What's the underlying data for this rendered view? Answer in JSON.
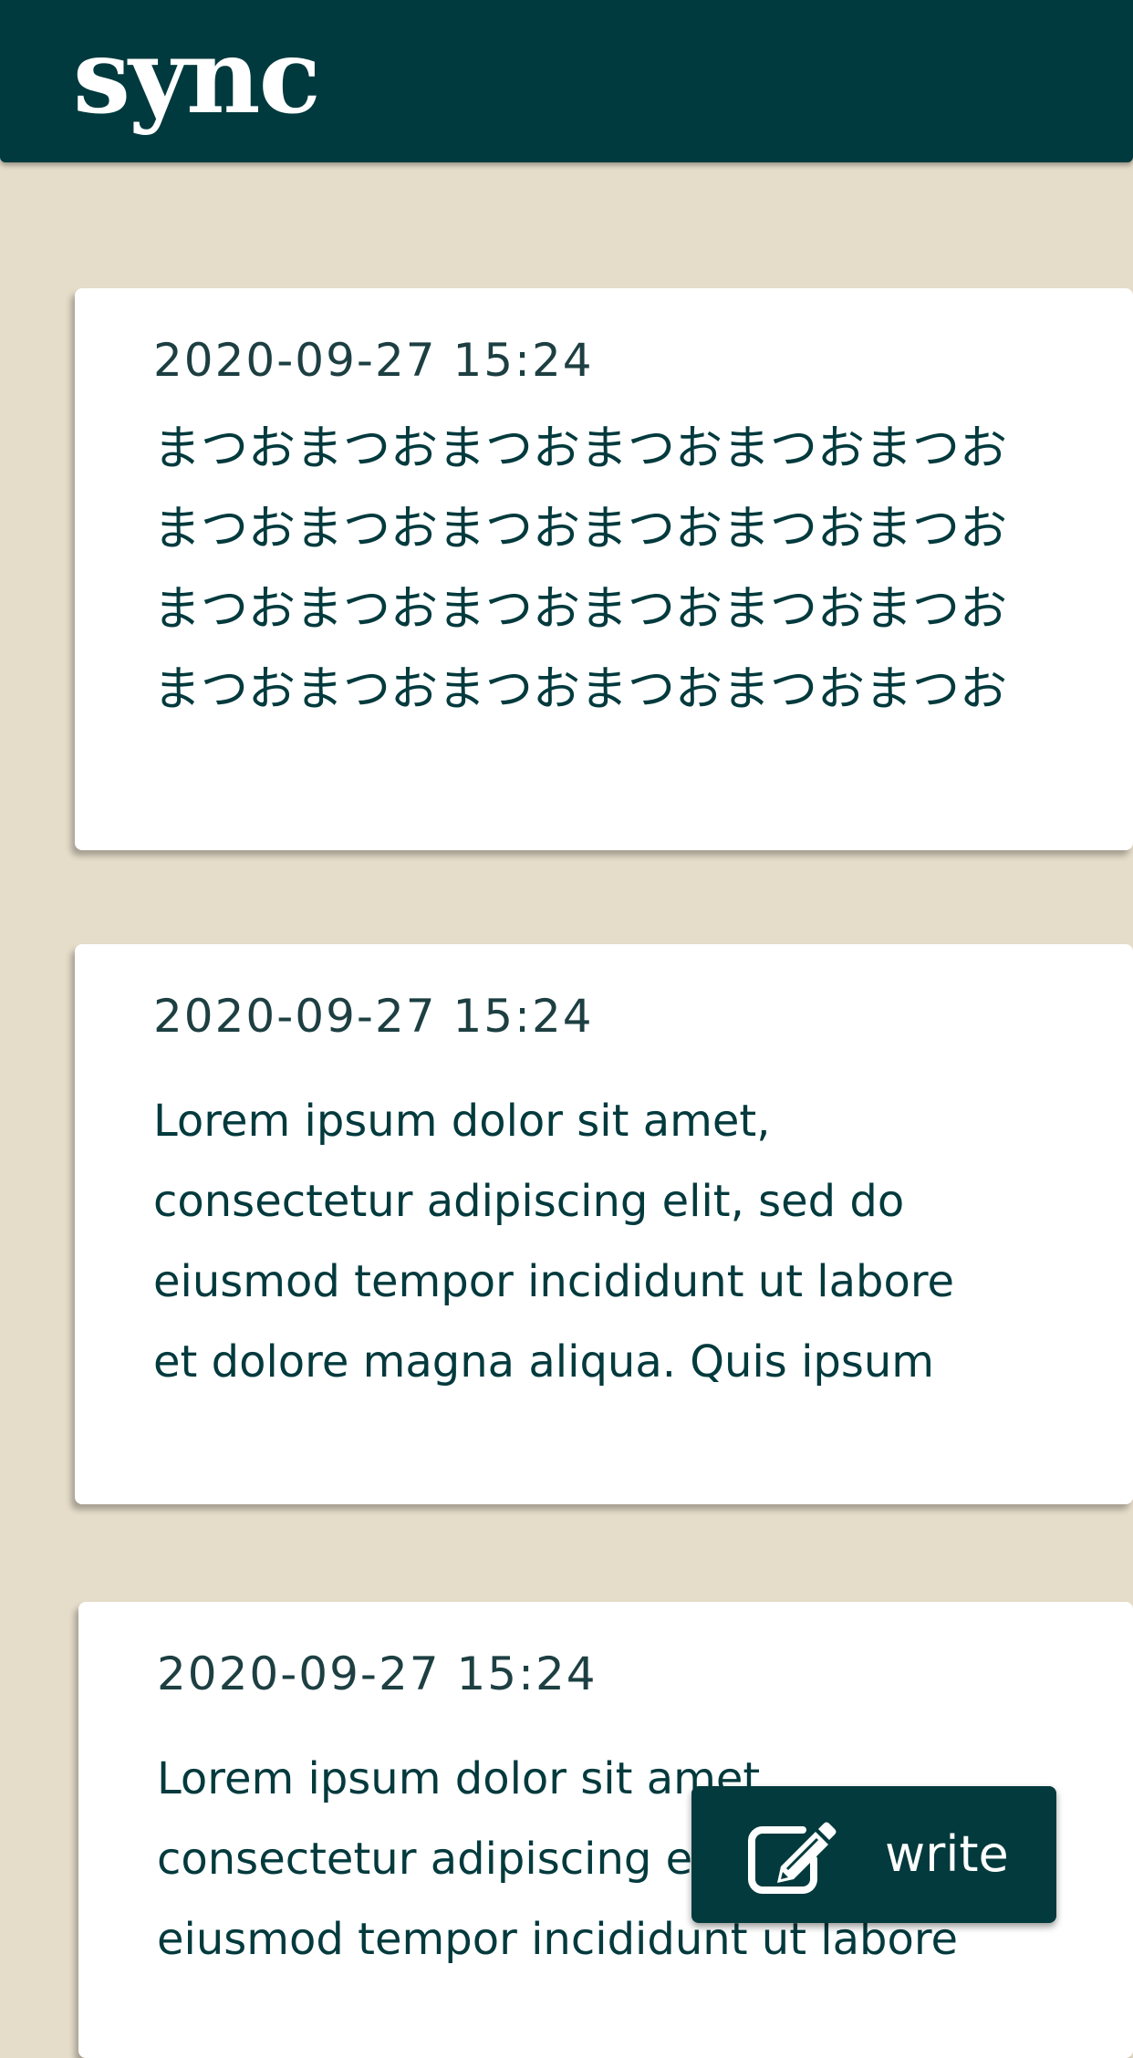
{
  "header": {
    "title": "sync"
  },
  "posts": [
    {
      "timestamp": "2020-09-27 15:24",
      "body": "まつおまつおまつおまつおまつおまつお\nまつおまつおまつおまつおまつおまつお\nまつおまつおまつおまつおまつおまつお\nまつおまつおまつおまつおまつおまつお"
    },
    {
      "timestamp": "2020-09-27 15:24",
      "body": "Lorem ipsum dolor sit amet,\nconsectetur adipiscing elit, sed do\neiusmod tempor incididunt ut labore\net dolore magna aliqua. Quis ipsum"
    },
    {
      "timestamp": "2020-09-27 15:24",
      "body": "Lorem ipsum dolor sit amet,\nconsectetur adipiscing elit, sed do\neiusmod tempor incididunt ut labore"
    }
  ],
  "fab": {
    "label": "write",
    "icon": "edit-icon"
  },
  "colors": {
    "header_bg": "#003a3e",
    "page_bg": "#e5dcc9",
    "card_bg": "#ffffff",
    "text": "#033a3d"
  }
}
